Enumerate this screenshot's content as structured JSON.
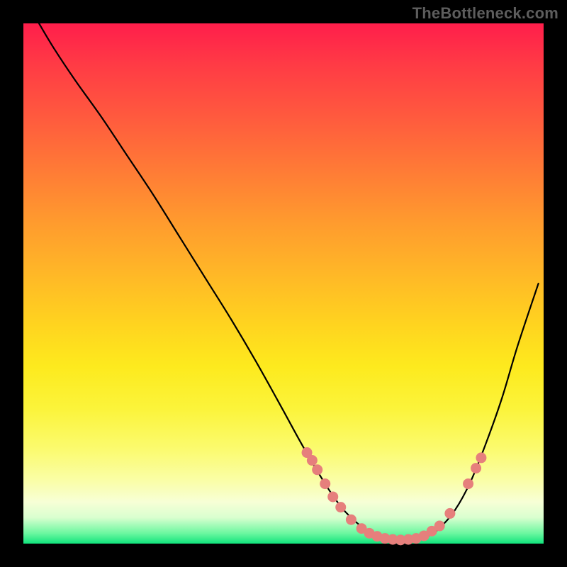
{
  "watermark": "TheBottleneck.com",
  "chart_data": {
    "type": "line",
    "title": "",
    "xlabel": "",
    "ylabel": "",
    "xlim": [
      0,
      100
    ],
    "ylim": [
      0,
      100
    ],
    "grid": false,
    "series": [
      {
        "name": "curve",
        "x": [
          3,
          6,
          10,
          15,
          20,
          25,
          30,
          35,
          40,
          45,
          50,
          53,
          55,
          58,
          60,
          62,
          65,
          68,
          72,
          75,
          78,
          80,
          83,
          86,
          89,
          92,
          95,
          99
        ],
        "values": [
          100,
          95,
          89,
          82,
          74.5,
          67,
          59,
          51,
          43,
          34.5,
          25.5,
          20,
          16.5,
          11.5,
          8.5,
          6,
          3.3,
          1.7,
          0.8,
          0.8,
          1.6,
          3,
          6.5,
          12,
          19.5,
          28,
          38,
          50
        ]
      }
    ],
    "points": [
      {
        "x": 54.5,
        "y": 17.5
      },
      {
        "x": 55.5,
        "y": 16.0
      },
      {
        "x": 56.5,
        "y": 14.2
      },
      {
        "x": 58.0,
        "y": 11.5
      },
      {
        "x": 59.5,
        "y": 9.0
      },
      {
        "x": 61.0,
        "y": 7.0
      },
      {
        "x": 63.0,
        "y": 4.6
      },
      {
        "x": 65.0,
        "y": 2.9
      },
      {
        "x": 66.5,
        "y": 2.0
      },
      {
        "x": 68.0,
        "y": 1.4
      },
      {
        "x": 69.5,
        "y": 1.0
      },
      {
        "x": 71.0,
        "y": 0.8
      },
      {
        "x": 72.5,
        "y": 0.7
      },
      {
        "x": 74.0,
        "y": 0.8
      },
      {
        "x": 75.5,
        "y": 1.0
      },
      {
        "x": 77.0,
        "y": 1.5
      },
      {
        "x": 78.5,
        "y": 2.4
      },
      {
        "x": 80.0,
        "y": 3.4
      },
      {
        "x": 82.0,
        "y": 5.8
      },
      {
        "x": 85.5,
        "y": 11.5
      },
      {
        "x": 87.0,
        "y": 14.5
      },
      {
        "x": 88.0,
        "y": 16.5
      }
    ],
    "gradient_stops": [
      {
        "pos": 0,
        "color": "#ff1e4b"
      },
      {
        "pos": 50,
        "color": "#ffc322"
      },
      {
        "pos": 90,
        "color": "#fbff9e"
      },
      {
        "pos": 100,
        "color": "#11e47c"
      }
    ]
  }
}
